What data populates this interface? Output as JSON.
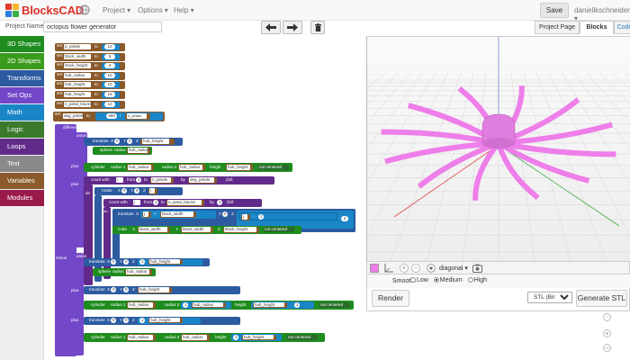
{
  "app": {
    "logo_text": "BlocksCAD"
  },
  "nav": {
    "project": "Project",
    "options": "Options",
    "help": "Help",
    "save": "Save",
    "user": "daniellkschneider"
  },
  "project": {
    "name_label": "Project Name",
    "name_value": "octopus flower generator"
  },
  "tabs": {
    "project_page": "Project Page",
    "blocks": "Blocks",
    "code": "Code"
  },
  "categories": [
    {
      "label": "3D Shapes",
      "color": "#1e8c1e"
    },
    {
      "label": "2D Shapes",
      "color": "#3a9b1c"
    },
    {
      "label": "Transforms",
      "color": "#2c5ba0"
    },
    {
      "label": "Set Ops",
      "color": "#7247c8"
    },
    {
      "label": "Math",
      "color": "#1a86c8"
    },
    {
      "label": "Logic",
      "color": "#3b7a2a"
    },
    {
      "label": "Loops",
      "color": "#612a8a"
    },
    {
      "label": "Text",
      "color": "#8a8a8a"
    },
    {
      "label": "Variables",
      "color": "#8a5a2b"
    },
    {
      "label": "Modules",
      "color": "#9a1a4a"
    }
  ],
  "blocks": {
    "set": "set",
    "to": "to",
    "vars": [
      {
        "name": "p_petals",
        "value": "12"
      },
      {
        "name": "block_width",
        "value": "5"
      },
      {
        "name": "block_height",
        "value": "2"
      },
      {
        "name": "hub_radius",
        "value": "10"
      },
      {
        "name": "hub_height",
        "value": "10"
      },
      {
        "name": "hub_height",
        "value": "15"
      },
      {
        "name": "n_petal_blocks",
        "value": "12"
      }
    ],
    "deg_petals_name": "deg_petals",
    "deg_petals_value": "360",
    "deg_petals_div": "/",
    "deg_petals_ref": "n_petals",
    "difference": "difference",
    "union": "union",
    "plus": "plus",
    "do": "do",
    "minus": "minus",
    "translate": "translate",
    "x": "X",
    "y": "Y",
    "z": "Z",
    "zero": "0",
    "sphere": "sphere",
    "radius": "radius",
    "hub_radius": "hub_radius",
    "hub_height": "hub_height",
    "cylinder": "cylinder",
    "radius1": "radius 1",
    "radius2": "radius 2",
    "height": "height",
    "not_centered": "not centered",
    "count_with": "count with",
    "from": "from",
    "by": "by",
    "deg_petals": "deg_petals",
    "full": "(full",
    "rotate": "rotate",
    "count_with_j": "count with",
    "n_petal_blocks": "n_petal_blocks",
    "cube": "cube",
    "block_width": "block_width",
    "block_height": "block_height",
    "minus_sign": "-",
    "times": "×",
    "two": "2",
    "one": "1"
  },
  "viewer": {
    "view_label": "diagonal",
    "smooth_label": "Smooth:",
    "smooth_options": [
      "Low",
      "Medium",
      "High"
    ],
    "smooth_selected": "Medium",
    "render": "Render",
    "format": "STL (Binary)",
    "generate": "Generate STL",
    "model_color": "#ee7ee9"
  },
  "icons": [
    "globe-icon",
    "undo-icon",
    "redo-icon",
    "trash-icon",
    "axes-icon",
    "zoom-in-icon",
    "zoom-out-icon",
    "target-icon",
    "camera-icon"
  ]
}
